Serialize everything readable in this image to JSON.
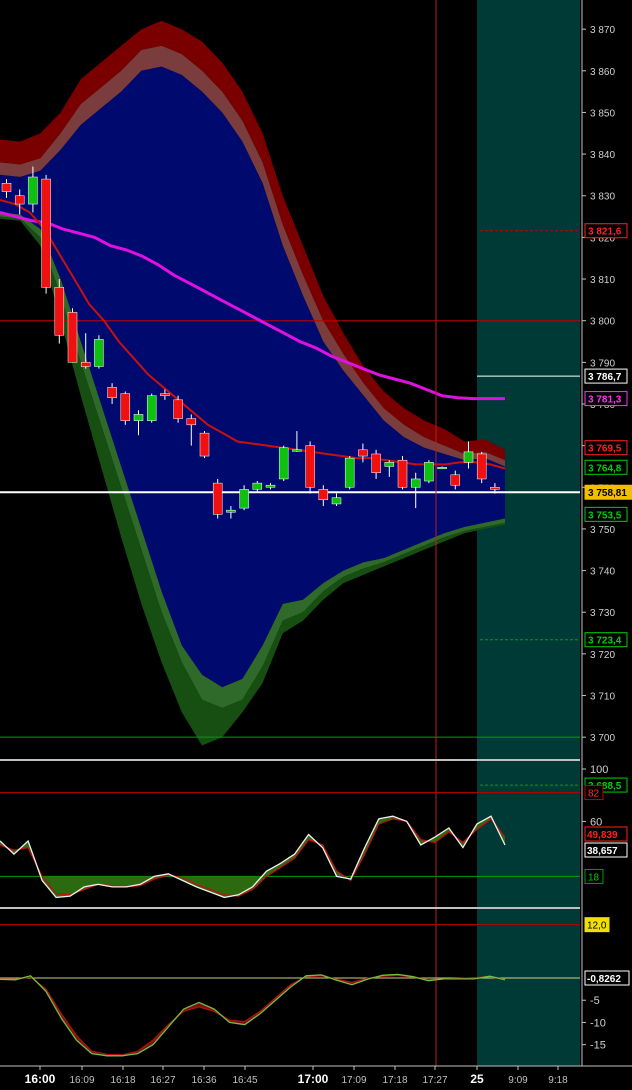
{
  "chart_data": {
    "type": "candlestick",
    "time_axis": {
      "labels": [
        "16:00",
        "16:09",
        "16:18",
        "16:27",
        "16:36",
        "16:45",
        "17:00",
        "17:09",
        "17:18",
        "17:27",
        "25",
        "9:09",
        "9:18"
      ],
      "bold_labels": [
        "16:00",
        "17:00",
        "25"
      ]
    },
    "price_panel": {
      "ylim": [
        3695,
        3877
      ],
      "ticks": [
        3700,
        3710,
        3720,
        3730,
        3740,
        3750,
        3760,
        3770,
        3780,
        3790,
        3800,
        3810,
        3820,
        3830,
        3840,
        3850,
        3860,
        3870
      ],
      "tick_labels": [
        "3 700",
        "3 710",
        "3 720",
        "3 730",
        "3 740",
        "3 750",
        "3 760",
        "3 770",
        "3 780",
        "3 790",
        "3 800",
        "3 810",
        "3 820",
        "3 830",
        "3 840",
        "3 850",
        "3 860",
        "3 870"
      ],
      "candles": [
        {
          "o": 3833.0,
          "h": 3834.0,
          "l": 3829.5,
          "c": 3831.0
        },
        {
          "o": 3830.0,
          "h": 3831.5,
          "l": 3825.5,
          "c": 3828.0
        },
        {
          "o": 3828.0,
          "h": 3837.0,
          "l": 3826.0,
          "c": 3834.5
        },
        {
          "o": 3834.0,
          "h": 3835.0,
          "l": 3806.5,
          "c": 3808.0
        },
        {
          "o": 3808.0,
          "h": 3810.0,
          "l": 3794.5,
          "c": 3796.5
        },
        {
          "o": 3802.0,
          "h": 3803.0,
          "l": 3790.0,
          "c": 3790.0
        },
        {
          "o": 3790.0,
          "h": 3797.0,
          "l": 3788.5,
          "c": 3789.0
        },
        {
          "o": 3789.0,
          "h": 3796.5,
          "l": 3788.5,
          "c": 3795.5
        },
        {
          "o": 3784.0,
          "h": 3785.0,
          "l": 3780.0,
          "c": 3781.5
        },
        {
          "o": 3782.5,
          "h": 3783.0,
          "l": 3775.0,
          "c": 3776.0
        },
        {
          "o": 3776.0,
          "h": 3778.5,
          "l": 3772.5,
          "c": 3777.5
        },
        {
          "o": 3776.0,
          "h": 3782.5,
          "l": 3775.5,
          "c": 3782.0
        },
        {
          "o": 3782.5,
          "h": 3783.5,
          "l": 3781.0,
          "c": 3782.0
        },
        {
          "o": 3781.0,
          "h": 3782.0,
          "l": 3775.5,
          "c": 3776.5
        },
        {
          "o": 3776.5,
          "h": 3777.5,
          "l": 3770.0,
          "c": 3775.0
        },
        {
          "o": 3773.0,
          "h": 3773.5,
          "l": 3767.0,
          "c": 3767.5
        },
        {
          "o": 3761.0,
          "h": 3762.0,
          "l": 3752.5,
          "c": 3753.5
        },
        {
          "o": 3754.0,
          "h": 3755.5,
          "l": 3752.5,
          "c": 3754.5
        },
        {
          "o": 3755.0,
          "h": 3760.5,
          "l": 3754.5,
          "c": 3759.5
        },
        {
          "o": 3759.5,
          "h": 3761.5,
          "l": 3759.0,
          "c": 3761.0
        },
        {
          "o": 3760.0,
          "h": 3761.0,
          "l": 3759.5,
          "c": 3760.5
        },
        {
          "o": 3762.0,
          "h": 3770.0,
          "l": 3761.5,
          "c": 3769.5
        },
        {
          "o": 3769.0,
          "h": 3773.5,
          "l": 3768.5,
          "c": 3769.0
        },
        {
          "o": 3770.0,
          "h": 3771.0,
          "l": 3758.5,
          "c": 3760.0
        },
        {
          "o": 3759.5,
          "h": 3760.5,
          "l": 3755.5,
          "c": 3757.0
        },
        {
          "o": 3756.0,
          "h": 3758.5,
          "l": 3755.5,
          "c": 3757.5
        },
        {
          "o": 3760.0,
          "h": 3767.5,
          "l": 3759.5,
          "c": 3767.0
        },
        {
          "o": 3769.0,
          "h": 3770.5,
          "l": 3766.0,
          "c": 3767.5
        },
        {
          "o": 3768.0,
          "h": 3769.0,
          "l": 3762.0,
          "c": 3763.5
        },
        {
          "o": 3765.0,
          "h": 3766.5,
          "l": 3762.5,
          "c": 3766.0
        },
        {
          "o": 3766.5,
          "h": 3767.5,
          "l": 3759.5,
          "c": 3760.0
        },
        {
          "o": 3760.0,
          "h": 3763.5,
          "l": 3755.0,
          "c": 3762.0
        },
        {
          "o": 3761.5,
          "h": 3766.5,
          "l": 3761.0,
          "c": 3766.0
        },
        {
          "o": 3764.5,
          "h": 3765.0,
          "l": 3764.5,
          "c": 3764.8
        },
        {
          "o": 3763.0,
          "h": 3764.0,
          "l": 3759.5,
          "c": 3760.5
        },
        {
          "o": 3766.0,
          "h": 3771.0,
          "l": 3764.5,
          "c": 3768.5
        },
        {
          "o": 3768.0,
          "h": 3768.5,
          "l": 3761.0,
          "c": 3762.0
        },
        {
          "o": 3760.0,
          "h": 3761.0,
          "l": 3758.5,
          "c": 3759.5
        }
      ],
      "ma_magenta": [
        3826.0,
        3825.0,
        3824.0,
        3823.5,
        3822.0,
        3821.0,
        3820.0,
        3818.0,
        3817.0,
        3815.5,
        3813.5,
        3811.0,
        3809.0,
        3807.0,
        3805.0,
        3803.0,
        3801.0,
        3799.0,
        3797.0,
        3795.0,
        3793.5,
        3791.5,
        3790.0,
        3788.5,
        3787.0,
        3786.0,
        3785.0,
        3783.5,
        3782.0,
        3781.5,
        3781.3,
        3781.3,
        3781.3
      ],
      "ma_red": [
        3829.0,
        3828.0,
        3826.0,
        3822.0,
        3816.0,
        3810.0,
        3804.0,
        3800.0,
        3795.0,
        3791.0,
        3787.0,
        3784.0,
        3781.0,
        3778.0,
        3775.0,
        3773.0,
        3771.0,
        3770.5,
        3770.0,
        3769.5,
        3769.0,
        3768.5,
        3768.0,
        3767.5,
        3767.0,
        3767.0,
        3766.5,
        3766.0,
        3765.5,
        3765.5,
        3765.5,
        3766.0,
        3766.0,
        3765.5,
        3764.5
      ],
      "band_upper_outer": [
        3843.5,
        3843.0,
        3845.0,
        3850.0,
        3858.0,
        3862.0,
        3866.0,
        3870.0,
        3872.0,
        3870.0,
        3867.0,
        3862.0,
        3855.0,
        3845.0,
        3830.0,
        3818.0,
        3806.0,
        3797.0,
        3789.0,
        3783.0,
        3779.0,
        3776.0,
        3774.0,
        3771.0,
        3771.5,
        3769.0
      ],
      "band_upper_mid": [
        3838.0,
        3837.5,
        3839.0,
        3845.0,
        3852.0,
        3856.0,
        3860.0,
        3865.0,
        3866.0,
        3864.0,
        3860.0,
        3855.0,
        3848.0,
        3838.0,
        3823.0,
        3811.0,
        3800.0,
        3792.0,
        3785.0,
        3779.0,
        3775.0,
        3772.0,
        3770.0,
        3768.0,
        3768.5,
        3766.5
      ],
      "band_upper_inner": [
        3835.0,
        3834.5,
        3836.0,
        3841.0,
        3847.0,
        3851.0,
        3855.0,
        3860.0,
        3861.0,
        3859.0,
        3855.0,
        3850.0,
        3843.0,
        3833.0,
        3818.0,
        3806.0,
        3795.0,
        3788.0,
        3782.0,
        3776.0,
        3772.0,
        3769.5,
        3768.0,
        3766.5,
        3767.0,
        3765.0
      ],
      "band_lower_inner": [
        3826.0,
        3825.5,
        3822.0,
        3810.0,
        3795.0,
        3780.0,
        3765.0,
        3750.0,
        3735.0,
        3722.0,
        3715.0,
        3712.0,
        3714.0,
        3722.0,
        3732.0,
        3733.0,
        3737.0,
        3740.0,
        3742.0,
        3743.0,
        3745.0,
        3747.0,
        3749.0,
        3750.5,
        3751.5,
        3752.5
      ],
      "band_lower_mid": [
        3825.0,
        3824.5,
        3820.0,
        3806.0,
        3790.0,
        3775.0,
        3760.0,
        3745.0,
        3730.0,
        3718.0,
        3709.0,
        3707.0,
        3709.0,
        3717.0,
        3728.0,
        3730.0,
        3735.0,
        3738.5,
        3740.5,
        3742.0,
        3744.0,
        3746.0,
        3748.0,
        3749.5,
        3750.5,
        3751.5
      ],
      "band_lower_outer": [
        3824.5,
        3824.0,
        3818.0,
        3800.0,
        3782.0,
        3765.0,
        3748.0,
        3732.0,
        3718.0,
        3706.0,
        3698.0,
        3700.0,
        3706.0,
        3713.0,
        3725.0,
        3728.0,
        3733.0,
        3737.0,
        3739.0,
        3741.0,
        3743.0,
        3745.0,
        3747.0,
        3749.0,
        3750.0,
        3751.0
      ],
      "hlines": [
        {
          "value": 3800.0,
          "color": "#c00000",
          "style": "solid"
        },
        {
          "value": 3700.0,
          "color": "#00a000",
          "style": "solid"
        },
        {
          "value": 3758.81,
          "color": "#ffffff",
          "style": "solid"
        }
      ],
      "price_tags": [
        {
          "text": "3 821,6",
          "value": 3821.6,
          "color": "#ff2020",
          "bg": "#000000"
        },
        {
          "text": "3 786,7",
          "value": 3786.7,
          "color": "#ffffff",
          "bg": "#000000"
        },
        {
          "text": "3 781,3",
          "value": 3781.3,
          "color": "#ff30ff",
          "bg": "#000000"
        },
        {
          "text": "3 769,5",
          "value": 3769.5,
          "color": "#ff2020",
          "bg": "#000000"
        },
        {
          "text": "3 764,8",
          "value": 3764.8,
          "color": "#00d000",
          "bg": "#000000"
        },
        {
          "text": "3 758,81",
          "value": 3758.81,
          "color": "#000000",
          "bg": "#f0c000"
        },
        {
          "text": "3 753,5",
          "value": 3753.5,
          "color": "#00d000",
          "bg": "#000000"
        },
        {
          "text": "3 723,4",
          "value": 3723.4,
          "color": "#00d000",
          "bg": "#000000"
        },
        {
          "text": "3 688,5",
          "value": 3688.5,
          "color": "#00d000",
          "bg": "#000000"
        }
      ]
    },
    "oscillator_panel_1": {
      "ylim": [
        0,
        100
      ],
      "tick_labels": [
        {
          "text": "100",
          "value": 100
        },
        {
          "text": "60",
          "value": 60
        }
      ],
      "levels": [
        {
          "value": 82,
          "color": "#c00000",
          "label": "82"
        },
        {
          "value": 18,
          "color": "#00a000",
          "label": "18"
        }
      ],
      "fast": [
        45,
        35,
        45,
        15,
        2,
        3,
        10,
        12,
        10,
        10,
        12,
        18,
        20,
        15,
        10,
        6,
        2,
        4,
        10,
        22,
        28,
        35,
        50,
        40,
        18,
        16,
        40,
        62,
        64,
        60,
        42,
        48,
        55,
        40,
        58,
        64,
        42
      ],
      "slow": [
        42,
        38,
        40,
        18,
        5,
        4,
        8,
        12,
        11,
        10,
        11,
        16,
        19,
        17,
        12,
        8,
        4,
        3,
        8,
        18,
        25,
        32,
        46,
        42,
        22,
        15,
        35,
        58,
        62,
        60,
        46,
        44,
        52,
        44,
        54,
        62,
        48
      ],
      "value_tags": [
        {
          "text": "49,839",
          "color": "#ff2020"
        },
        {
          "text": "38,657",
          "color": "#ffffff"
        }
      ]
    },
    "oscillator_panel_2": {
      "ylim": [
        -18,
        13.5
      ],
      "tick_labels": [
        {
          "text": "-5",
          "value": -5
        },
        {
          "text": "-10",
          "value": -10
        },
        {
          "text": "-15",
          "value": -15
        }
      ],
      "level": {
        "value": 12.0,
        "label": "12,0"
      },
      "fast": [
        -0.3,
        -0.4,
        0.5,
        -3.0,
        -9.0,
        -14.0,
        -17.0,
        -17.5,
        -17.5,
        -17.0,
        -15.0,
        -11.0,
        -7.0,
        -5.5,
        -7.0,
        -10.0,
        -10.5,
        -8.0,
        -5.0,
        -2.0,
        0.5,
        0.7,
        -0.5,
        -1.5,
        -0.3,
        0.6,
        0.8,
        0.3,
        -0.6,
        -0.2,
        -0.2,
        -0.2,
        0.4,
        -0.4
      ],
      "slow": [
        -0.2,
        -0.3,
        0.2,
        -2.5,
        -8.0,
        -13.0,
        -16.5,
        -17.2,
        -17.3,
        -16.5,
        -14.0,
        -10.5,
        -7.5,
        -6.5,
        -7.5,
        -9.5,
        -9.8,
        -7.5,
        -4.5,
        -1.5,
        0.3,
        0.5,
        -0.3,
        -1.0,
        -0.1,
        0.4,
        0.6,
        0.2,
        -0.4,
        -0.2,
        -0.1,
        0.1,
        0.3,
        -0.3
      ],
      "value_tag": {
        "text": "-0,8262",
        "color": "#ffffff"
      }
    }
  }
}
